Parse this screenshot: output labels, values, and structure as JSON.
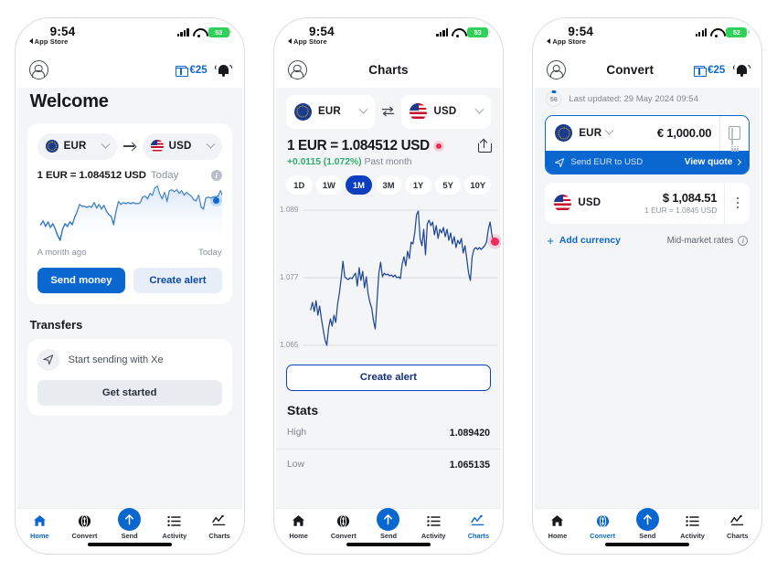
{
  "status_bar": {
    "time": "9:54",
    "back_label": "App Store",
    "battery_1": "53",
    "battery_2": "53",
    "battery_3": "52"
  },
  "panel1": {
    "header": {
      "gift_amount": "€25",
      "title": ""
    },
    "welcome": "Welcome",
    "from_currency": "EUR",
    "to_currency": "USD",
    "rate_text": "1 EUR = 1.084512 USD",
    "rate_when": "Today",
    "chart_start_label": "A month ago",
    "chart_end_label": "Today",
    "send_money_label": "Send money",
    "create_alert_label": "Create alert",
    "transfers_title": "Transfers",
    "start_sending_label": "Start sending with Xe",
    "get_started_label": "Get started",
    "tabs": [
      {
        "label": "Home",
        "active": true
      },
      {
        "label": "Convert",
        "active": false
      },
      {
        "label": "Send",
        "active": false
      },
      {
        "label": "Activity",
        "active": false
      },
      {
        "label": "Charts",
        "active": false
      }
    ]
  },
  "panel2": {
    "title": "Charts",
    "from_currency": "EUR",
    "to_currency": "USD",
    "rate_text": "1 EUR = 1.084512 USD",
    "delta_value": "+0.0115 (1.072%)",
    "delta_period": "Past month",
    "ranges": [
      {
        "label": "1D",
        "active": false
      },
      {
        "label": "1W",
        "active": false
      },
      {
        "label": "1M",
        "active": true
      },
      {
        "label": "3M",
        "active": false
      },
      {
        "label": "1Y",
        "active": false
      },
      {
        "label": "5Y",
        "active": false
      },
      {
        "label": "10Y",
        "active": false
      }
    ],
    "y_labels": [
      "1.089",
      "1.077",
      "1.065"
    ],
    "create_alert_label": "Create alert",
    "stats_title": "Stats",
    "stats": [
      {
        "key": "High",
        "value": "1.089420"
      },
      {
        "key": "Low",
        "value": "1.065135"
      }
    ],
    "tabs": [
      {
        "label": "Home",
        "active": false
      },
      {
        "label": "Convert",
        "active": false
      },
      {
        "label": "Send",
        "active": false
      },
      {
        "label": "Activity",
        "active": false
      },
      {
        "label": "Charts",
        "active": true
      }
    ]
  },
  "panel3": {
    "title": "Convert",
    "gift_amount": "€25",
    "timer_seconds": "56",
    "last_updated": "Last updated: 29 May 2024 09:54",
    "from_currency": "EUR",
    "from_amount": "€ 1,000.00",
    "send_banner": "Send EUR to USD",
    "view_quote": "View quote",
    "to_currency": "USD",
    "to_amount": "$ 1,084.51",
    "to_rate": "1 EUR = 1.0845 USD",
    "add_currency": "Add currency",
    "mid_market": "Mid-market rates",
    "tabs": [
      {
        "label": "Home",
        "active": false
      },
      {
        "label": "Convert",
        "active": true
      },
      {
        "label": "Send",
        "active": false
      },
      {
        "label": "Activity",
        "active": false
      },
      {
        "label": "Charts",
        "active": false
      }
    ]
  },
  "chart_data": {
    "type": "line",
    "title": "1 EUR = 1.084512 USD",
    "subtitle": "+0.0115 (1.072%) Past month",
    "xlabel": "",
    "ylabel": "",
    "ylim": [
      1.065,
      1.089
    ],
    "yticks": [
      1.065,
      1.077,
      1.089
    ],
    "grid": true,
    "legend": "none",
    "x_range_label": "Past month",
    "stats": {
      "high": 1.08942,
      "low": 1.065135
    },
    "series": [
      {
        "name": "EUR/USD",
        "values": [
          1.0715,
          1.0724,
          1.0708,
          1.0727,
          1.0702,
          1.0718,
          1.07,
          1.0692,
          1.0673,
          1.0651,
          1.0687,
          1.0706,
          1.0699,
          1.0716,
          1.0706,
          1.0729,
          1.0742,
          1.077,
          1.0764,
          1.0763,
          1.0761,
          1.0762,
          1.0758,
          1.0772,
          1.0755,
          1.0768,
          1.0751,
          1.0762,
          1.0744,
          1.0733,
          1.0727,
          1.0696,
          1.0742,
          1.0774,
          1.0766,
          1.0771,
          1.0768,
          1.077,
          1.0767,
          1.0769,
          1.0766,
          1.0769,
          1.0788,
          1.079,
          1.0782,
          1.08,
          1.0796,
          1.0832,
          1.089,
          1.086,
          1.0842,
          1.0863,
          1.083,
          1.0868,
          1.087,
          1.0866,
          1.0873,
          1.0858,
          1.0869,
          1.0852,
          1.0861,
          1.0855,
          1.0848,
          1.0836,
          1.0833,
          1.0849,
          1.0816,
          1.081,
          1.0843,
          1.0845,
          1.0844,
          1.0845,
          1.0847,
          1.0851,
          1.0846,
          1.0858,
          1.0874,
          1.0862,
          1.0845
        ]
      }
    ]
  }
}
